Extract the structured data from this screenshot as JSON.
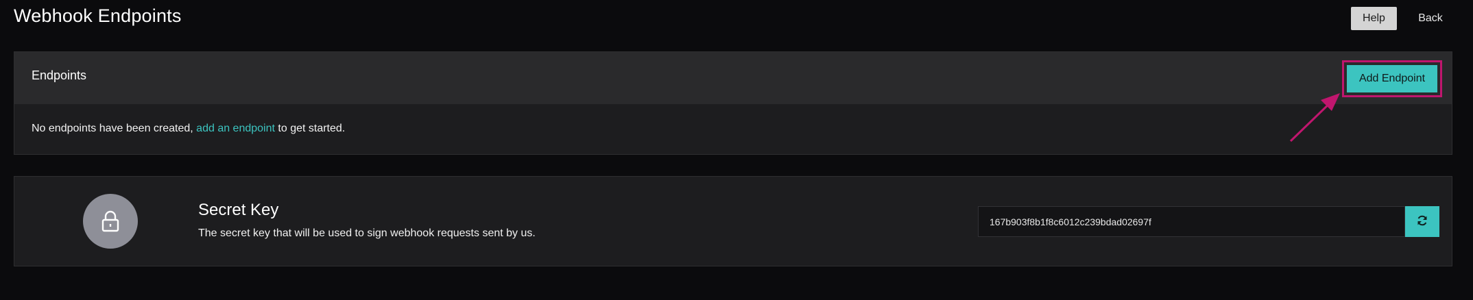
{
  "header": {
    "title": "Webhook Endpoints",
    "help_label": "Help",
    "back_label": "Back"
  },
  "endpoints": {
    "title": "Endpoints",
    "add_button_label": "Add Endpoint",
    "empty_prefix": "No endpoints have been created, ",
    "empty_link": "add an endpoint",
    "empty_suffix": " to get started."
  },
  "secret": {
    "icon": "lock-icon",
    "title": "Secret Key",
    "description": "The secret key that will be used to sign webhook requests sent by us.",
    "key_value": "167b903f8b1f8c6012c239bdad02697f",
    "refresh_icon": "refresh-icon"
  },
  "colors": {
    "accent": "#3cc4c0",
    "highlight": "#c0166e",
    "background": "#0b0b0d",
    "panel": "#1d1d1f",
    "panel_header": "#2a2a2c"
  }
}
